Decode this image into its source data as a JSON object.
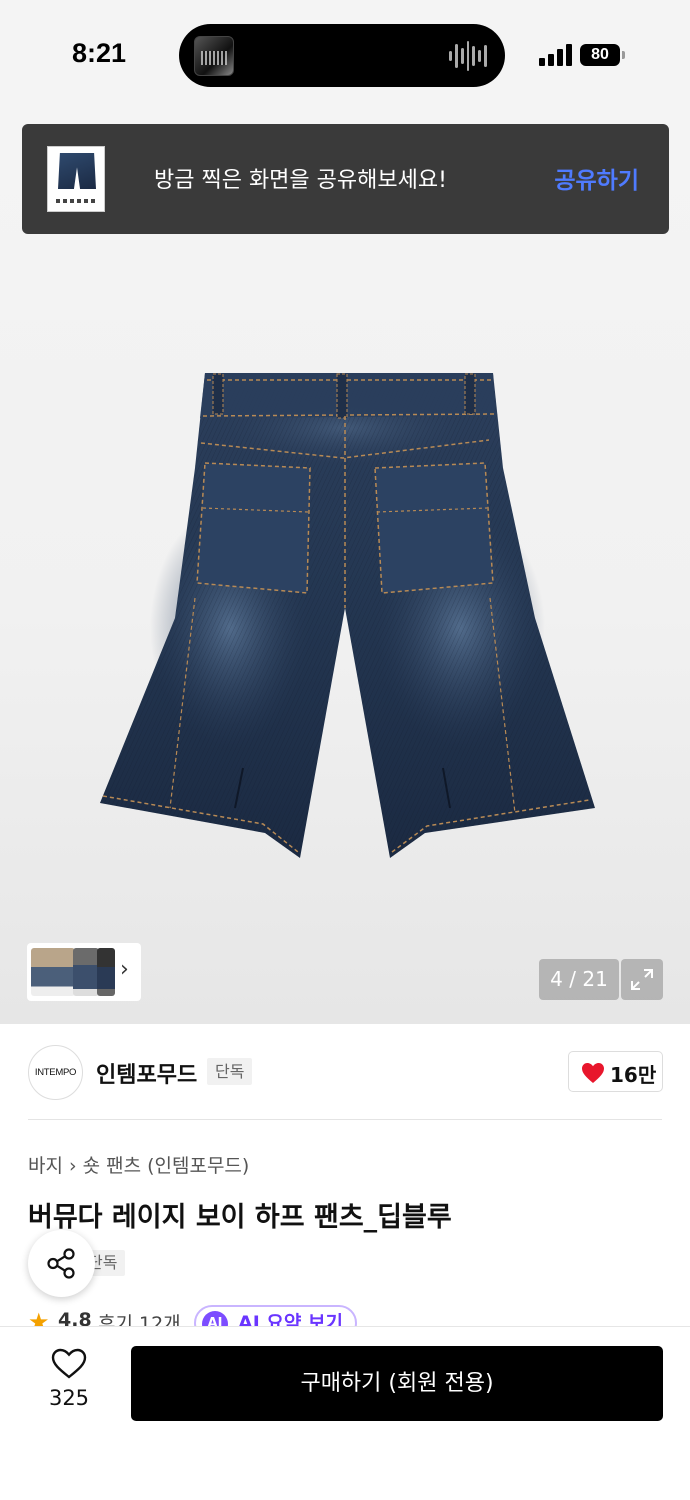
{
  "status_bar": {
    "time": "8:21",
    "battery": "80",
    "icons": [
      "signal-icon",
      "battery-icon",
      "now-playing-icon"
    ]
  },
  "share_toast": {
    "message": "방금 찍은 화면을 공유해보세요!",
    "action_label": "공유하기",
    "action_color": "#4f7bff"
  },
  "gallery": {
    "counter": "4 / 21",
    "icons": [
      "chevron-right-icon",
      "expand-icon"
    ]
  },
  "brand": {
    "logo_text": "INTEMPO",
    "name": "인템포무드",
    "badge": "단독",
    "like_count": "16만"
  },
  "product": {
    "breadcrumb": [
      "바지",
      "숏 팬츠 (인템포무드)"
    ],
    "title": "버뮤다 레이지 보이 하프 팬츠_딥블루",
    "badge": "단독",
    "rating": "4.8",
    "reviews": "후기 12개",
    "ai_icon_text": "AI",
    "ai_label": "AI 요약 보기"
  },
  "bottom_bar": {
    "wish_count": "325",
    "buy_label": "구매하기 (회원 전용)",
    "accent_color": "#000000"
  }
}
